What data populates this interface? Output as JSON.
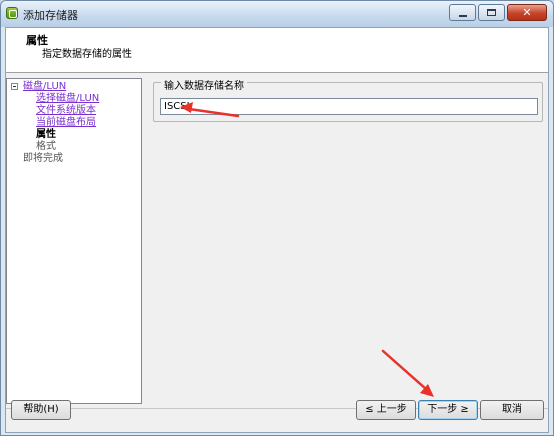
{
  "window": {
    "title": "添加存储器"
  },
  "header": {
    "title": "属性",
    "subtitle": "指定数据存储的属性"
  },
  "nav": {
    "items": [
      {
        "label": "磁盘/LUN"
      },
      {
        "label": "选择磁盘/LUN"
      },
      {
        "label": "文件系统版本"
      },
      {
        "label": "当前磁盘布局"
      },
      {
        "label": "属性"
      },
      {
        "label": "格式"
      },
      {
        "label": "即将完成"
      }
    ]
  },
  "form": {
    "group_label": "输入数据存储名称",
    "datastore_name": "ISCSI"
  },
  "buttons": {
    "help": "帮助(H)",
    "back": "≤ 上一步",
    "next": "下一步 ≥",
    "cancel": "取消"
  },
  "colors": {
    "annotation_arrow": "#e8322a",
    "link": "#7a2fd0"
  }
}
